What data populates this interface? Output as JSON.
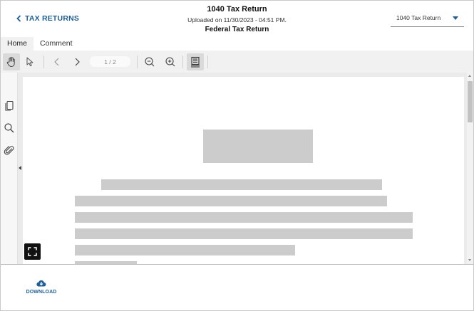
{
  "header": {
    "back_label": "TAX RETURNS",
    "title": "1040 Tax Return",
    "uploaded": "Uploaded on 11/30/2023 - 04:51 PM.",
    "subtitle": "Federal Tax Return"
  },
  "document_select": {
    "selected": "1040 Tax Return"
  },
  "tabs": [
    {
      "label": "Home",
      "active": true
    },
    {
      "label": "Comment",
      "active": false
    }
  ],
  "toolbar": {
    "icons": [
      "pan-hand-icon",
      "select-pointer-icon",
      "prev-page-icon",
      "next-page-icon",
      "zoom-out-icon",
      "zoom-in-icon",
      "single-page-view-icon"
    ],
    "page_indicator": "1 / 2"
  },
  "sidebar": {
    "icons": [
      "thumbnails-icon",
      "search-icon",
      "attachment-icon"
    ]
  },
  "footer": {
    "download_label": "DOWNLOAD"
  },
  "colors": {
    "accent": "#1d5f9c",
    "toolbar_bg": "#f1f1f1",
    "viewer_bg": "#ebebeb",
    "placeholder": "#cccccc"
  }
}
